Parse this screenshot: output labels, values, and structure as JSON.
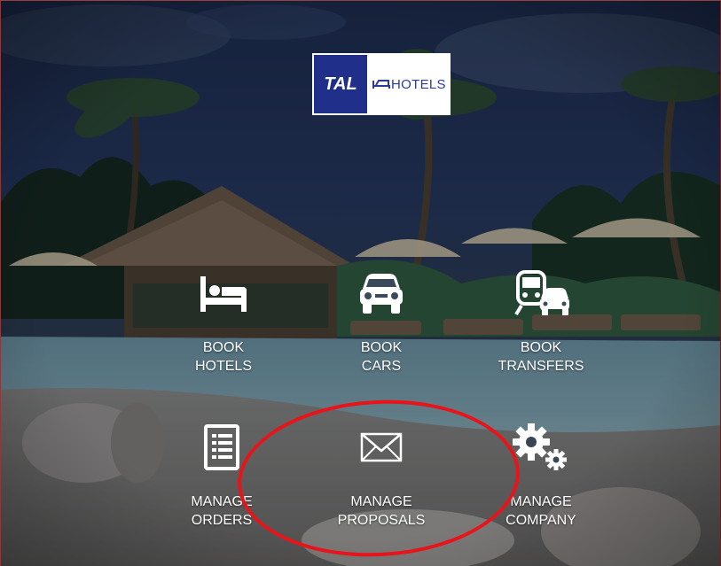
{
  "logo": {
    "left_text": "TAL",
    "right_text": "HOTELS"
  },
  "menu": [
    {
      "id": "book-hotels",
      "line1": "BOOK",
      "line2": "HOTELS",
      "icon": "bed-icon"
    },
    {
      "id": "book-cars",
      "line1": "BOOK",
      "line2": "CARS",
      "icon": "car-icon"
    },
    {
      "id": "book-transfers",
      "line1": "BOOK",
      "line2": "TRANSFERS",
      "icon": "train-car-icon"
    },
    {
      "id": "manage-orders",
      "line1": "MANAGE",
      "line2": "ORDERS",
      "icon": "document-list-icon"
    },
    {
      "id": "manage-proposals",
      "line1": "MANAGE",
      "line2": "PROPOSALS",
      "icon": "envelope-icon"
    },
    {
      "id": "manage-company",
      "line1": "MANAGE",
      "line2": "COMPANY",
      "icon": "gears-icon"
    }
  ],
  "colors": {
    "annotation": "#e8141a",
    "logo_blue": "#1f2f8a",
    "text": "#ffffff"
  }
}
